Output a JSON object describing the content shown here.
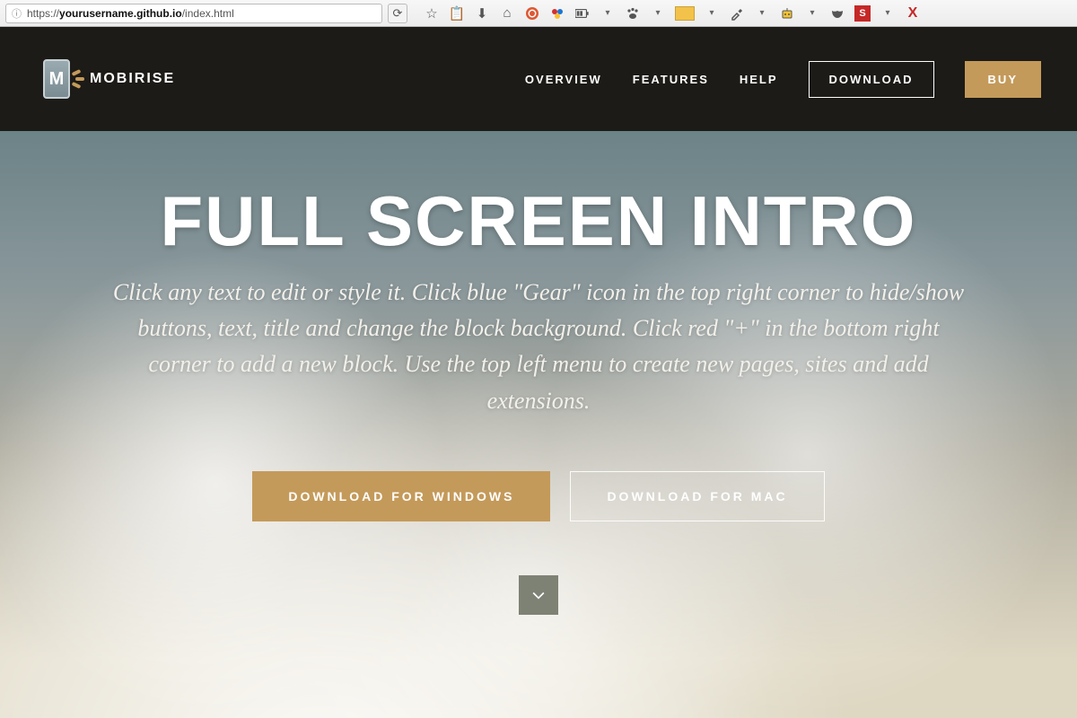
{
  "browser": {
    "url_prefix": "https://",
    "url_host": "yourusername.github.io",
    "url_path": "/index.html"
  },
  "header": {
    "brand_letter": "M",
    "brand_name": "MOBIRISE",
    "nav": {
      "overview": "OVERVIEW",
      "features": "FEATURES",
      "help": "HELP"
    },
    "download_label": "DOWNLOAD",
    "buy_label": "BUY"
  },
  "hero": {
    "title": "FULL SCREEN INTRO",
    "subtitle": "Click any text to edit or style it. Click blue \"Gear\" icon in the top right corner to hide/show buttons, text, title and change the block background.\nClick red \"+\" in the bottom right corner to add a new block. Use the top left menu to create new pages, sites and add extensions.",
    "btn_windows": "DOWNLOAD FOR WINDOWS",
    "btn_mac": "DOWNLOAD FOR MAC"
  },
  "colors": {
    "gold": "#c49a5a",
    "header_bg": "#1c1b17"
  }
}
